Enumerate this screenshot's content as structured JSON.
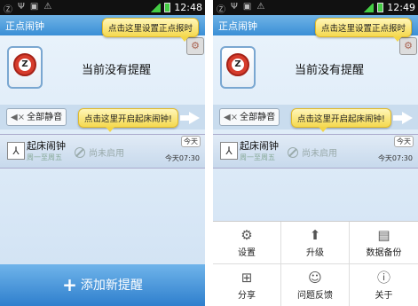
{
  "status_bar": {
    "time_left": "12:48",
    "time_right": "12:49"
  },
  "app": {
    "title": "正点闹钟",
    "set_chime_tip": "点击这里设置正点报时",
    "logo_letter": "Z",
    "no_reminder": "当前没有提醒",
    "mute_all": "全部静音",
    "enable_alarm_tip": "点击这里开启起床闹钟!",
    "add_reminder": "添加新提醒"
  },
  "alarm": {
    "name": "起床闹钟",
    "days": "周一至周五",
    "state": "尚未启用",
    "today_badge": "今天",
    "next_time": "今天07:30"
  },
  "menu": {
    "settings": "设置",
    "upgrade": "升级",
    "backup": "数据备份",
    "share": "分享",
    "feedback": "问题反馈",
    "about": "关于"
  },
  "icons": {
    "settings": "gear-icon",
    "upgrade": "upload-arrow-icon",
    "backup": "backup-icon",
    "share": "share-icon",
    "feedback": "chat-bubble-icon",
    "about": "info-icon"
  }
}
